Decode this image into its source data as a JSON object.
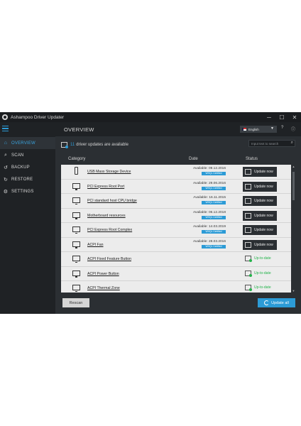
{
  "window": {
    "title": "Ashampoo Driver Updater"
  },
  "window_buttons": {
    "minimize": "─",
    "maximize": "☐",
    "close": "✕"
  },
  "sidebar": {
    "items": [
      {
        "label": "OVERVIEW",
        "icon": "home-icon",
        "glyph": "⌂",
        "active": true
      },
      {
        "label": "SCAN",
        "icon": "search-icon",
        "glyph": "⌕",
        "active": false
      },
      {
        "label": "BACKUP",
        "icon": "backup-icon",
        "glyph": "↺",
        "active": false
      },
      {
        "label": "RESTORE",
        "icon": "restore-icon",
        "glyph": "↻",
        "active": false
      },
      {
        "label": "SETTINGS",
        "icon": "gear-icon",
        "glyph": "⚙",
        "active": false
      }
    ]
  },
  "header": {
    "title": "OVERVIEW",
    "language": "English",
    "language_arrow": "▼",
    "help": "?",
    "info": "ⓘ"
  },
  "notice": {
    "count": "11",
    "text": "driver updates are available"
  },
  "search": {
    "placeholder": "Input text to search",
    "icon": "⌕"
  },
  "table": {
    "headers": {
      "category": "Category",
      "date": "Date",
      "status": "Status"
    },
    "rows": [
      {
        "name": "USB Mass Storage Device",
        "icon": "usb-icon",
        "available": "Available: 09.12.2016",
        "badge": "WHQL Certified",
        "status": "Update now",
        "up_to_date": false
      },
      {
        "name": "PCI Express Root Port",
        "icon": "monitor-icon",
        "available": "Available: 29.06.2016",
        "badge": "WHQL Certified",
        "status": "Update now",
        "up_to_date": false
      },
      {
        "name": "PCI standard host CPU bridge",
        "icon": "monitor-icon",
        "available": "Available: 16.11.2015",
        "badge": "WHQL Certified",
        "status": "Update now",
        "up_to_date": false
      },
      {
        "name": "Motherboard resources",
        "icon": "monitor-icon",
        "available": "Available: 06.12.2018",
        "badge": "WHQL Certified",
        "status": "Update now",
        "up_to_date": false
      },
      {
        "name": "PCI Express Root Complex",
        "icon": "monitor-icon",
        "available": "Available: 14.03.2019",
        "badge": "WHQL Certified",
        "status": "Update now",
        "up_to_date": false
      },
      {
        "name": "ACPI Fan",
        "icon": "monitor-icon",
        "available": "Available: 28.03.2016",
        "badge": "WHQL Certified",
        "status": "Update now",
        "up_to_date": false
      },
      {
        "name": "ACPI Fixed Feature Button",
        "icon": "monitor-icon",
        "available": "",
        "badge": "",
        "status": "Up-to-date",
        "up_to_date": true
      },
      {
        "name": "ACPI Power Button",
        "icon": "monitor-icon",
        "available": "",
        "badge": "",
        "status": "Up-to-date",
        "up_to_date": true
      },
      {
        "name": "ACPI Thermal Zone",
        "icon": "monitor-icon",
        "available": "",
        "badge": "",
        "status": "Up-to-date",
        "up_to_date": true
      }
    ]
  },
  "footer": {
    "rescan": "Rescan",
    "update_all": "Update all"
  },
  "colors": {
    "accent": "#2c9bd6",
    "ok": "#23b34a",
    "panel": "#2b2f33",
    "sidebar": "#1f2225"
  }
}
